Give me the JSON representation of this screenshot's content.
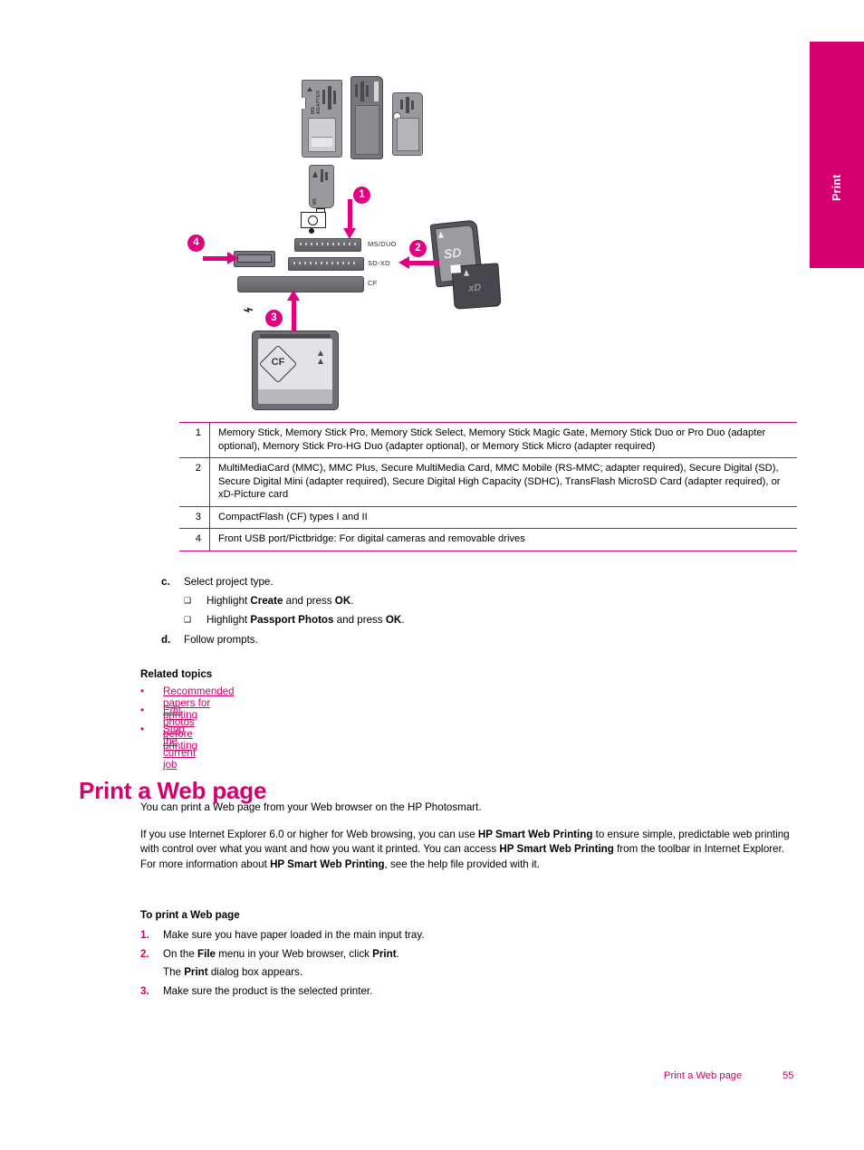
{
  "side_tab": {
    "label": "Print"
  },
  "illustration": {
    "slot_labels": [
      "MS/DUO",
      "SD-XD",
      "CF"
    ],
    "card_marks": {
      "sd": "SD",
      "xd": "xD",
      "cf": "CF",
      "ms_adapter": "MS ADAPTER",
      "ms_micro": "MS"
    },
    "callouts": [
      "1",
      "2",
      "3",
      "4"
    ],
    "icons": {
      "camera": "camera-icon",
      "usb": "usb-pictbridge-icon"
    }
  },
  "spec_table": {
    "rows": [
      {
        "num": "1",
        "text": "Memory Stick, Memory Stick Pro, Memory Stick Select, Memory Stick Magic Gate, Memory Stick Duo or Pro Duo (adapter optional), Memory Stick Pro-HG Duo (adapter optional), or Memory Stick Micro (adapter required)"
      },
      {
        "num": "2",
        "text": "MultiMediaCard (MMC), MMC Plus, Secure MultiMedia Card, MMC Mobile (RS-MMC; adapter required), Secure Digital (SD), Secure Digital Mini (adapter required), Secure Digital High Capacity (SDHC), TransFlash MicroSD Card (adapter required), or xD-Picture card"
      },
      {
        "num": "3",
        "text": "CompactFlash (CF) types I and II"
      },
      {
        "num": "4",
        "text": "Front USB port/Pictbridge: For digital cameras and removable drives"
      }
    ]
  },
  "procedure": {
    "step_c_marker": "c.",
    "step_c_text": "Select project type.",
    "bullets": [
      {
        "pre": "Highlight ",
        "bold1": "Create",
        "mid": " and press ",
        "bold2": "OK",
        "post": "."
      },
      {
        "pre": "Highlight ",
        "bold1": "Passport Photos",
        "mid": " and press ",
        "bold2": "OK",
        "post": "."
      }
    ],
    "step_d_marker": "d.",
    "step_d_text": "Follow prompts."
  },
  "related": {
    "heading": "Related topics",
    "bullet": "•",
    "links": [
      "Recommended papers for printing",
      "Edit photos before printing",
      "Stop the current job"
    ]
  },
  "section": {
    "title": "Print a Web page",
    "para1": "You can print a Web page from your Web browser on the HP Photosmart.",
    "para2": {
      "t1": "If you use Internet Explorer 6.0 or higher for Web browsing, you can use ",
      "b1": "HP Smart Web Printing",
      "t2": " to ensure simple, predictable web printing with control over what you want and how you want it printed. You can access ",
      "b2": "HP Smart Web Printing",
      "t3": " from the toolbar in Internet Explorer. For more information about ",
      "b3": "HP Smart Web Printing",
      "t4": ", see the help file provided with it."
    }
  },
  "howto": {
    "heading": "To print a Web page",
    "steps": [
      {
        "num": "1.",
        "t1": "Make sure you have paper loaded in the main input tray.",
        "b1": "",
        "t2": "",
        "b2": "",
        "t3": ""
      },
      {
        "num": "2.",
        "t1": "On the ",
        "b1": "File",
        "t2": " menu in your Web browser, click ",
        "b2": "Print",
        "t3": "."
      },
      {
        "num": "3.",
        "t1": "Make sure the product is the selected printer.",
        "b1": "",
        "t2": "",
        "b2": "",
        "t3": ""
      }
    ],
    "step2_sub": {
      "t1": "The ",
      "b1": "Print",
      "t2": " dialog box appears."
    }
  },
  "footer": {
    "title": "Print a Web page",
    "page": "55"
  },
  "colors": {
    "accent": "#d5006d",
    "rule": "#c8007a",
    "callout": "#e3007f"
  }
}
